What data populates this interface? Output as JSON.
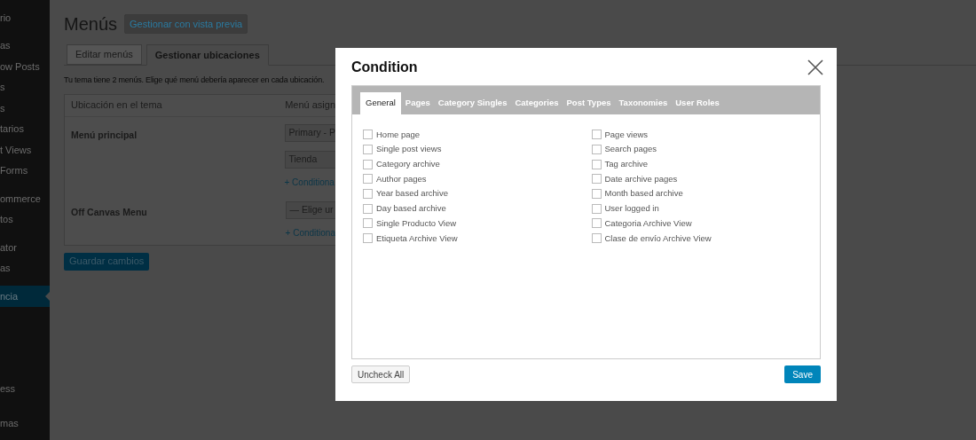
{
  "sidebar": {
    "groups": [
      [
        {
          "label": "rio",
          "selected": false
        }
      ],
      [
        {
          "label": "as",
          "selected": false
        },
        {
          "label": "ow Posts",
          "selected": false
        },
        {
          "label": "s",
          "selected": false
        },
        {
          "label": "s",
          "selected": false
        },
        {
          "label": "tarios",
          "selected": false
        },
        {
          "label": "t Views",
          "selected": false
        },
        {
          "label": "Forms",
          "selected": false
        }
      ],
      [
        {
          "label": "ommerce",
          "selected": false
        },
        {
          "label": "tos",
          "selected": false
        }
      ],
      [
        {
          "label": "ator",
          "selected": false
        },
        {
          "label": "as",
          "selected": false
        }
      ],
      [
        {
          "label": "ncia",
          "selected": true
        }
      ],
      [
        {
          "label": "ess",
          "selected": false
        }
      ],
      [
        {
          "label": "mas",
          "selected": false
        }
      ]
    ]
  },
  "page": {
    "title": "Menús",
    "preview_button": "Gestionar con vista previa",
    "tabs": [
      {
        "label": "Editar menús",
        "selected": false
      },
      {
        "label": "Gestionar ubicaciones",
        "selected": true
      }
    ],
    "description": "Tu tema tiene 2 menús. Elige qué menú debería aparecer en cada ubicación.",
    "table": {
      "columns": [
        "Ubicación en el tema",
        "Menú asign"
      ],
      "rows": [
        {
          "location": "Menú principal",
          "selects": [
            "Primary - P",
            "Tienda"
          ],
          "link": "+ Conditiona"
        },
        {
          "location": "Off Canvas Menu",
          "selects": [
            "— Elige ur"
          ],
          "link": "+ Conditiona"
        }
      ]
    },
    "save_button": "Guardar cambios"
  },
  "dialog": {
    "title": "Condition",
    "tabs": [
      {
        "label": "General",
        "selected": true
      },
      {
        "label": "Pages",
        "selected": false
      },
      {
        "label": "Category Singles",
        "selected": false
      },
      {
        "label": "Categories",
        "selected": false
      },
      {
        "label": "Post Types",
        "selected": false
      },
      {
        "label": "Taxonomies",
        "selected": false
      },
      {
        "label": "User Roles",
        "selected": false
      }
    ],
    "options": [
      {
        "label": "Home page",
        "checked": false
      },
      {
        "label": "Page views",
        "checked": false
      },
      {
        "label": "Single post views",
        "checked": false
      },
      {
        "label": "Search pages",
        "checked": false
      },
      {
        "label": "Category archive",
        "checked": false
      },
      {
        "label": "Tag archive",
        "checked": false
      },
      {
        "label": "Author pages",
        "checked": false
      },
      {
        "label": "Date archive pages",
        "checked": false
      },
      {
        "label": "Year based archive",
        "checked": false
      },
      {
        "label": "Month based archive",
        "checked": false
      },
      {
        "label": "Day based archive",
        "checked": false
      },
      {
        "label": "User logged in",
        "checked": false
      },
      {
        "label": "Single Producto View",
        "checked": false
      },
      {
        "label": "Categoria Archive View",
        "checked": false
      },
      {
        "label": "Etiqueta Archive View",
        "checked": false
      },
      {
        "label": "Clase de envío Archive View",
        "checked": false
      }
    ],
    "uncheck_button": "Uncheck All",
    "save_button": "Save"
  }
}
